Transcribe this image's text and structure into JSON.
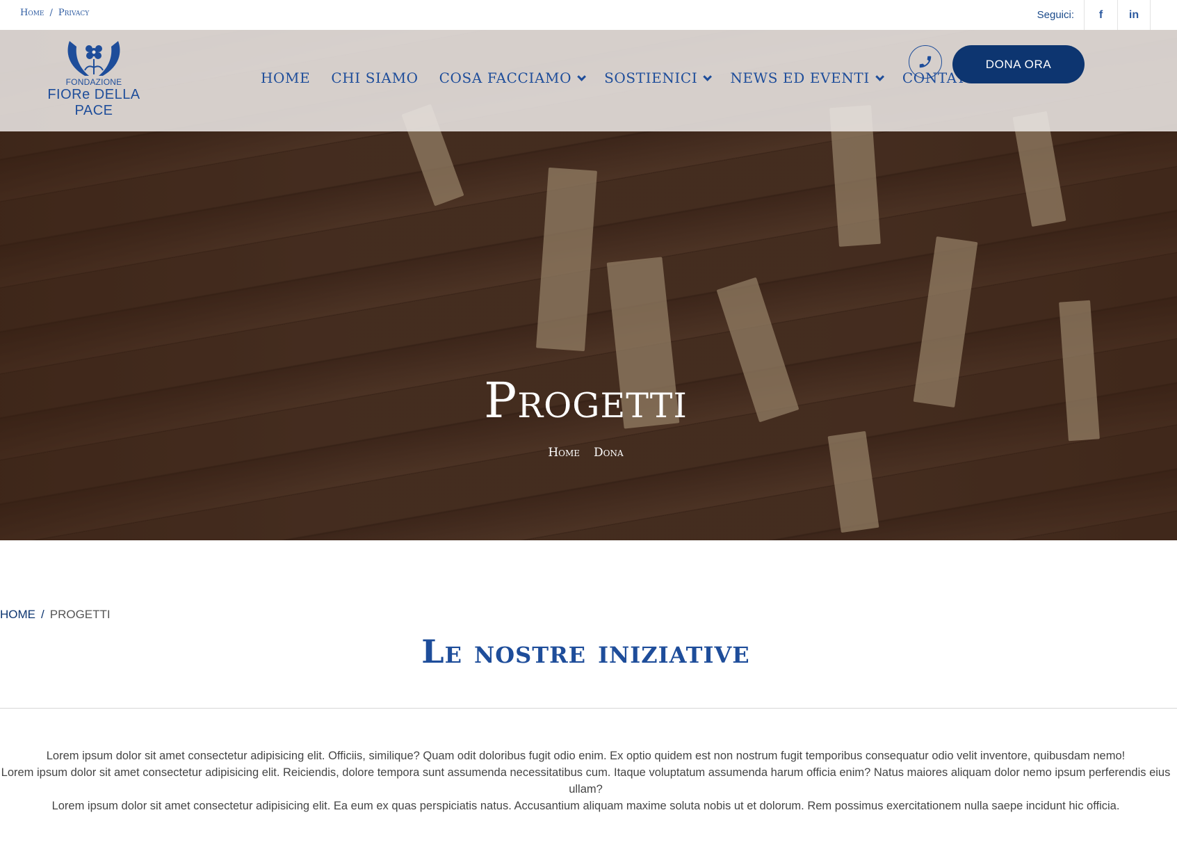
{
  "topbar": {
    "crumbs": [
      "Home",
      "Privacy"
    ],
    "follow_label": "Seguici:",
    "social": [
      {
        "label": "f",
        "icon": "facebook-icon"
      },
      {
        "label": "in",
        "icon": "linkedin-icon"
      }
    ]
  },
  "logo": {
    "small": "FONDAZIONE",
    "big": "FIORe DELLA PACE"
  },
  "nav": {
    "items": [
      {
        "label": "HOME",
        "dropdown": false
      },
      {
        "label": "CHI SIAMO",
        "dropdown": false
      },
      {
        "label": "COSA FACCIAMO",
        "dropdown": true
      },
      {
        "label": "SOSTIENICI",
        "dropdown": true
      },
      {
        "label": "NEWS ED EVENTI",
        "dropdown": true
      },
      {
        "label": "CONTATTI",
        "dropdown": false
      }
    ],
    "donate_label": "DONA ORA"
  },
  "hero": {
    "title": "Progetti",
    "crumbs": [
      "Home",
      "Dona"
    ]
  },
  "content": {
    "breadcrumb": {
      "home": "HOME",
      "current": "PROGETTI"
    },
    "title": "Le nostre iniziative",
    "paragraphs": [
      "Lorem ipsum dolor sit amet consectetur adipisicing elit. Officiis, similique? Quam odit doloribus fugit odio enim. Ex optio quidem est non nostrum fugit temporibus consequatur odio velit inventore, quibusdam nemo!",
      "Lorem ipsum dolor sit amet consectetur adipisicing elit. Reiciendis, dolore tempora sunt assumenda necessitatibus cum. Itaque voluptatum assumenda harum officia enim? Natus maiores aliquam dolor nemo ipsum perferendis eius ullam?",
      "Lorem ipsum dolor sit amet consectetur adipisicing elit. Ea eum ex quas perspiciatis natus. Accusantium aliquam maxime soluta nobis ut et dolorum. Rem possimus exercitationem nulla saepe incidunt hic officia."
    ]
  },
  "colors": {
    "brand_blue": "#1e4d9a",
    "dark_blue": "#0d3570"
  }
}
